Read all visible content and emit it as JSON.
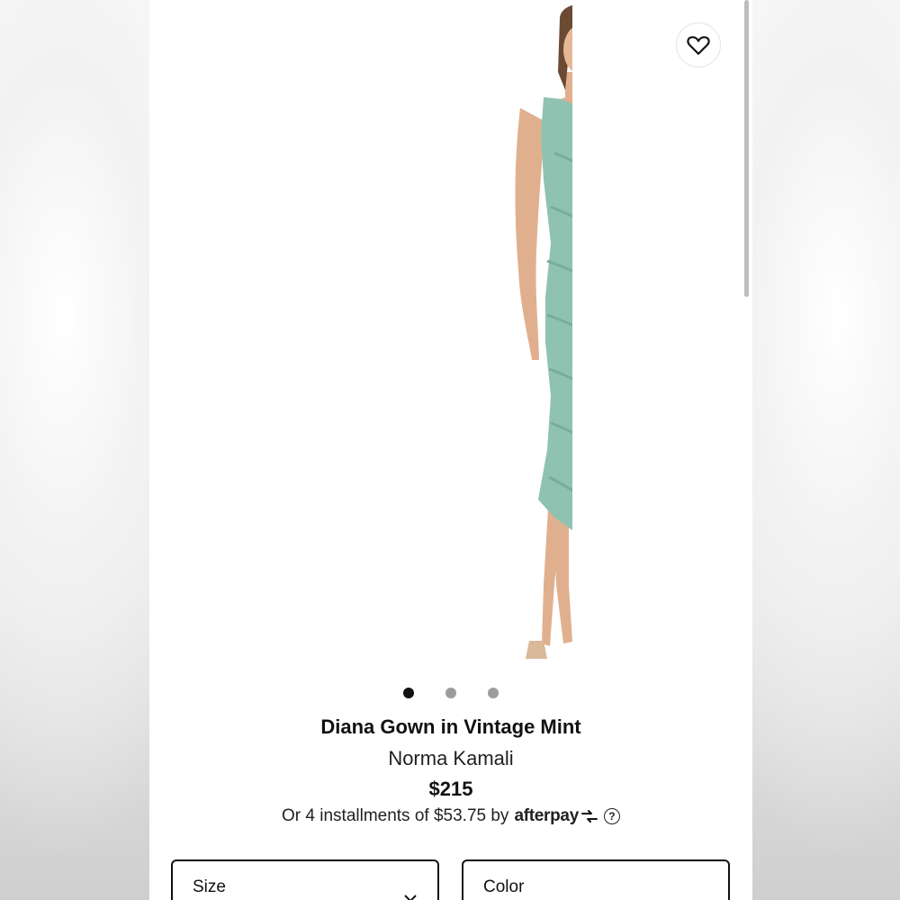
{
  "product": {
    "title": "Diana Gown in Vintage Mint",
    "brand": "Norma Kamali",
    "price": "$215",
    "installments_text": "Or 4 installments of $53.75 by",
    "payment_provider": "afterpay",
    "help_glyph": "?",
    "dress_color": "#8fc2b1"
  },
  "carousel": {
    "total_images": 3,
    "active_index": 0
  },
  "options": {
    "size_label": "Size",
    "color_label": "Color"
  },
  "icons": {
    "wishlist": "heart-icon",
    "help": "question-icon",
    "afterpay_logo": "afterpay-arrows-icon"
  }
}
